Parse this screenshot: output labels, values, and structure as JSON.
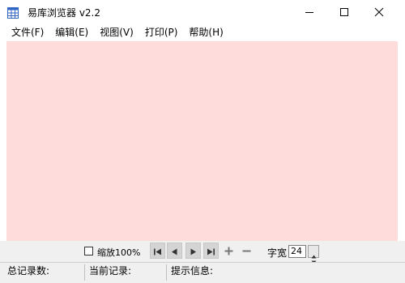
{
  "window": {
    "title": "易库浏览器 v2.2",
    "icons": {
      "app": "table-app-icon",
      "minimize": "minimize-icon",
      "maximize": "maximize-icon",
      "close": "close-icon"
    }
  },
  "menu": {
    "items": [
      {
        "label": "文件(F)"
      },
      {
        "label": "编辑(E)"
      },
      {
        "label": "视图(V)"
      },
      {
        "label": "打印(P)"
      },
      {
        "label": "帮助(H)"
      }
    ]
  },
  "content": {
    "background_color": "#ffdcdc"
  },
  "toolbar": {
    "zoom_label": "缩放100%",
    "zoom_checked": false,
    "nav_icons": [
      "first-record-icon",
      "previous-record-icon",
      "next-record-icon",
      "last-record-icon",
      "plus-icon",
      "minus-icon"
    ],
    "width_label": "字宽",
    "width_value": "24"
  },
  "status": {
    "total_label": "总记录数:",
    "current_label": "当前记录:",
    "hint_label": "提示信息:"
  }
}
